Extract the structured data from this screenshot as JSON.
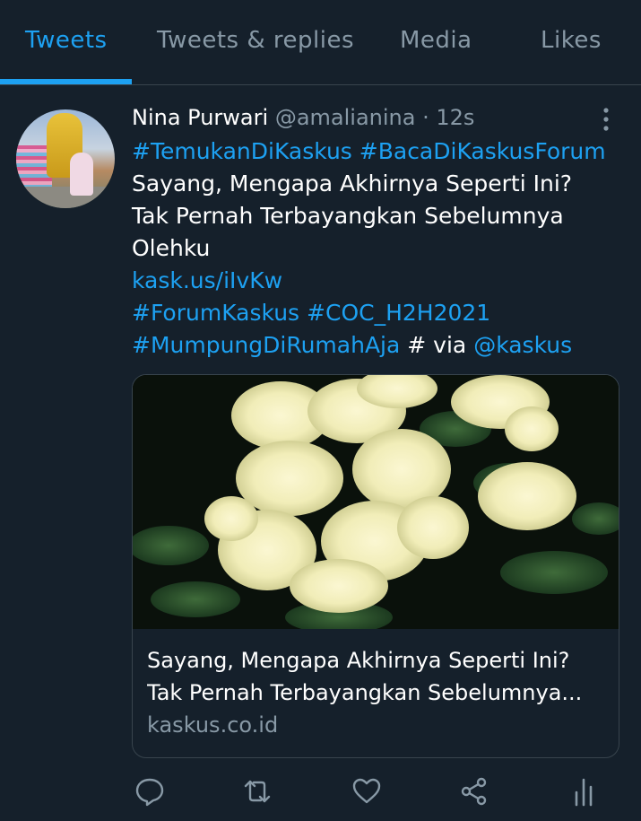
{
  "tabs": [
    {
      "label": "Tweets"
    },
    {
      "label": "Tweets & replies"
    },
    {
      "label": "Media"
    },
    {
      "label": "Likes"
    }
  ],
  "tweet": {
    "author_name": "Nina Purwari",
    "handle": "@amalianina",
    "time": " · 12s",
    "line1": "#TemukanDiKaskus #BacaDiKaskusForum",
    "line2": "Sayang, Mengapa Akhirnya Seperti Ini?",
    "line3": "Tak Pernah Terbayangkan Sebelumnya",
    "line4": "Olehku",
    "url": "kask.us/iIvKw",
    "hashtag1": "#ForumKaskus",
    "hashtag2": "#COC_H2H2021",
    "hashtag3": "#MumpungDiRumahAja",
    "tail_text": " # via ",
    "mention": "@kaskus"
  },
  "card": {
    "title_line1": "Sayang, Mengapa Akhirnya Seperti Ini?",
    "title_line2": "Tak Pernah Terbayangkan Sebelumnya...",
    "domain": "kaskus.co.id",
    "image_subject": "pale yellow rhododendron flowers on dark background"
  },
  "icons": {
    "more": "more-vertical-icon",
    "reply": "reply-icon",
    "retweet": "retweet-icon",
    "like": "heart-icon",
    "share": "share-icon",
    "analytics": "analytics-icon"
  },
  "colors": {
    "background": "#15202b",
    "accent": "#1da1f2",
    "muted": "#8899a6",
    "border": "#38444d"
  }
}
